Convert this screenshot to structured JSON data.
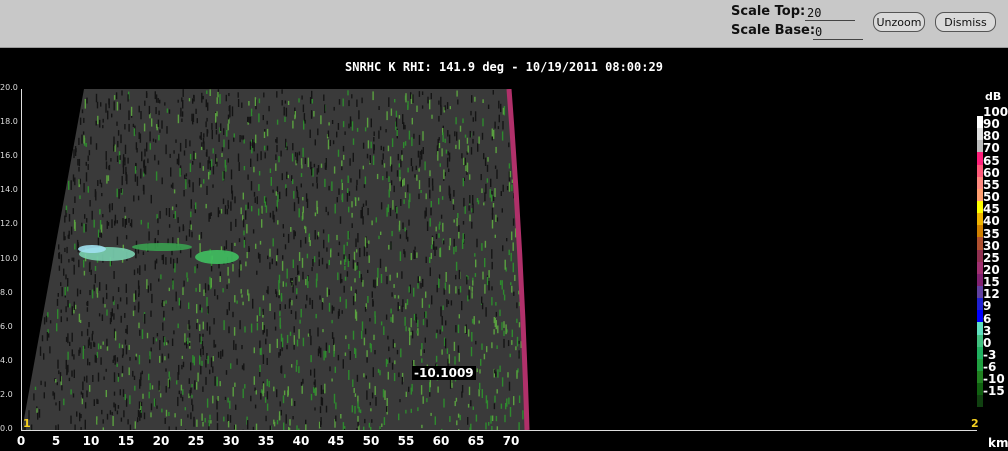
{
  "toolbar": {
    "scale_top_label": "Scale Top:",
    "scale_top_value": "20",
    "scale_base_label": "Scale Base:",
    "scale_base_value": "0",
    "unzoom_label": "Unzoom",
    "dismiss_label": "Dismiss"
  },
  "plot_title": "SNRHC K  RHI: 141.9 deg  -  10/19/2011 08:00:29",
  "cursor_readout": "-10.1009",
  "corner_left": "1",
  "corner_right": "2",
  "colors": {
    "toolbar_bg": "#c8c8c8",
    "noise": "#3a3a3a",
    "signal": "#2e9a2e",
    "edge": "#b0306a"
  },
  "chart_data": {
    "type": "heatmap",
    "xlabel": "km",
    "x_ticks": [
      "0",
      "5",
      "10",
      "15",
      "20",
      "25",
      "30",
      "35",
      "40",
      "45",
      "50",
      "55",
      "60",
      "65",
      "70"
    ],
    "xlim": [
      0,
      70
    ],
    "y_ticks": [
      "0.0",
      "2.0",
      "4.0",
      "6.0",
      "8.0",
      "10.0",
      "12.0",
      "14.0",
      "16.0",
      "18.0",
      "20.0"
    ],
    "ylim": [
      0,
      20
    ],
    "colorbar": {
      "unit": "dB",
      "labels": [
        "100",
        "90",
        "80",
        "70",
        "65",
        "60",
        "55",
        "50",
        "45",
        "40",
        "35",
        "30",
        "25",
        "20",
        "15",
        "12",
        "9",
        "6",
        "3",
        "0",
        "-3",
        "-6",
        "-10",
        "-15"
      ],
      "colors": [
        "#ffffff",
        "#e0e0e0",
        "#bcbcbc",
        "#ff1f7a",
        "#ff5a7a",
        "#ff8a80",
        "#ff9f70",
        "#ffff00",
        "#f0b400",
        "#d08000",
        "#b05030",
        "#903050",
        "#a03070",
        "#802070",
        "#6040a0",
        "#2020d0",
        "#0000ff",
        "#60e0c0",
        "#40c080",
        "#20b060",
        "#20a040",
        "#208020",
        "#106010",
        "#104010"
      ]
    }
  }
}
